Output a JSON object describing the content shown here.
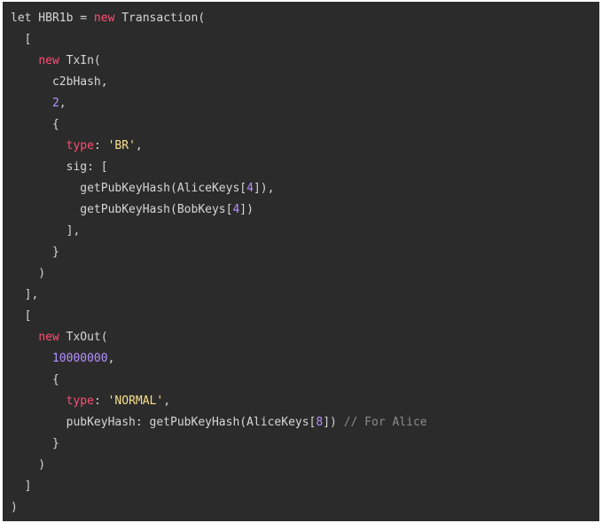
{
  "colors": {
    "background": "#2b2b2b",
    "text": "#d6d6d6",
    "keyword": "#ff4f73",
    "string": "#f8e08e",
    "number": "#b690ff",
    "comment": "#8c8c8c"
  },
  "code": {
    "lines": [
      [
        {
          "t": "plain",
          "s": "let HBR1b = "
        },
        {
          "t": "kw",
          "s": "new"
        },
        {
          "t": "plain",
          "s": " Transaction("
        }
      ],
      [
        {
          "t": "plain",
          "s": "  ["
        }
      ],
      [
        {
          "t": "plain",
          "s": "    "
        },
        {
          "t": "kw",
          "s": "new"
        },
        {
          "t": "plain",
          "s": " TxIn("
        }
      ],
      [
        {
          "t": "plain",
          "s": "      c2bHash,"
        }
      ],
      [
        {
          "t": "plain",
          "s": "      "
        },
        {
          "t": "num",
          "s": "2"
        },
        {
          "t": "plain",
          "s": ","
        }
      ],
      [
        {
          "t": "plain",
          "s": "      {"
        }
      ],
      [
        {
          "t": "plain",
          "s": "        "
        },
        {
          "t": "kw",
          "s": "type"
        },
        {
          "t": "plain",
          "s": ": "
        },
        {
          "t": "str",
          "s": "'BR'"
        },
        {
          "t": "plain",
          "s": ","
        }
      ],
      [
        {
          "t": "plain",
          "s": "        sig: ["
        }
      ],
      [
        {
          "t": "plain",
          "s": "          getPubKeyHash(AliceKeys["
        },
        {
          "t": "num",
          "s": "4"
        },
        {
          "t": "plain",
          "s": "]),"
        }
      ],
      [
        {
          "t": "plain",
          "s": "          getPubKeyHash(BobKeys["
        },
        {
          "t": "num",
          "s": "4"
        },
        {
          "t": "plain",
          "s": "])"
        }
      ],
      [
        {
          "t": "plain",
          "s": "        ],"
        }
      ],
      [
        {
          "t": "plain",
          "s": "      }"
        }
      ],
      [
        {
          "t": "plain",
          "s": "    )"
        }
      ],
      [
        {
          "t": "plain",
          "s": "  ],"
        }
      ],
      [
        {
          "t": "plain",
          "s": "  ["
        }
      ],
      [
        {
          "t": "plain",
          "s": "    "
        },
        {
          "t": "kw",
          "s": "new"
        },
        {
          "t": "plain",
          "s": " TxOut("
        }
      ],
      [
        {
          "t": "plain",
          "s": "      "
        },
        {
          "t": "num",
          "s": "10000000"
        },
        {
          "t": "plain",
          "s": ","
        }
      ],
      [
        {
          "t": "plain",
          "s": "      {"
        }
      ],
      [
        {
          "t": "plain",
          "s": "        "
        },
        {
          "t": "kw",
          "s": "type"
        },
        {
          "t": "plain",
          "s": ": "
        },
        {
          "t": "str",
          "s": "'NORMAL'"
        },
        {
          "t": "plain",
          "s": ","
        }
      ],
      [
        {
          "t": "plain",
          "s": "        pubKeyHash: getPubKeyHash(AliceKeys["
        },
        {
          "t": "num",
          "s": "8"
        },
        {
          "t": "plain",
          "s": "]) "
        },
        {
          "t": "cmt",
          "s": "// For Alice"
        }
      ],
      [
        {
          "t": "plain",
          "s": "      }"
        }
      ],
      [
        {
          "t": "plain",
          "s": "    )"
        }
      ],
      [
        {
          "t": "plain",
          "s": "  ]"
        }
      ],
      [
        {
          "t": "plain",
          "s": ")"
        }
      ]
    ]
  }
}
